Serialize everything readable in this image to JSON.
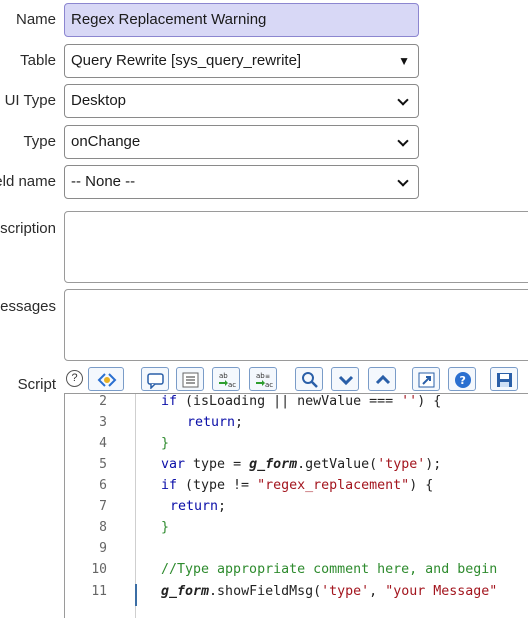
{
  "form": {
    "name_label": "Name",
    "name_value": "Regex Replacement Warning",
    "table_label": "Table",
    "table_value": "Query Rewrite [sys_query_rewrite]",
    "ui_type_label": "UI Type",
    "ui_type_value": "Desktop",
    "type_label": "Type",
    "type_value": "onChange",
    "field_name_label": "eld name",
    "field_name_value": "-- None --",
    "description_label": "scription",
    "messages_label": "lessages",
    "script_label": "Script"
  },
  "toolbar": {
    "help_glyph": "?",
    "buttons": [
      "format-code",
      "comment",
      "list",
      "replace",
      "replace-all",
      "search",
      "next",
      "previous",
      "expand",
      "help",
      "save"
    ]
  },
  "editor": {
    "line_numbers": [
      "2",
      "3",
      "4",
      "5",
      "6",
      "7",
      "8",
      "9",
      "10",
      "11"
    ],
    "lines": {
      "l2a": "if",
      "l2b": " (isLoading || newValue === ",
      "l2c": "''",
      "l2d": ") {",
      "l3a": "return",
      "l3b": ";",
      "l4": "}",
      "l5a": "var",
      "l5b": " type = ",
      "l5c": "g_form",
      "l5d": ".getValue(",
      "l5e": "'type'",
      "l5f": ");",
      "l6a": "if",
      "l6b": " (type != ",
      "l6c": "\"regex_replacement\"",
      "l6d": ") {",
      "l7a": "return",
      "l7b": ";",
      "l8": "}",
      "l10": "//Type appropriate comment here, and begin",
      "l11a": "g_form",
      "l11b": ".showFieldMsg(",
      "l11c": "'type'",
      "l11d": ", ",
      "l11e": "\"your Message\""
    }
  }
}
